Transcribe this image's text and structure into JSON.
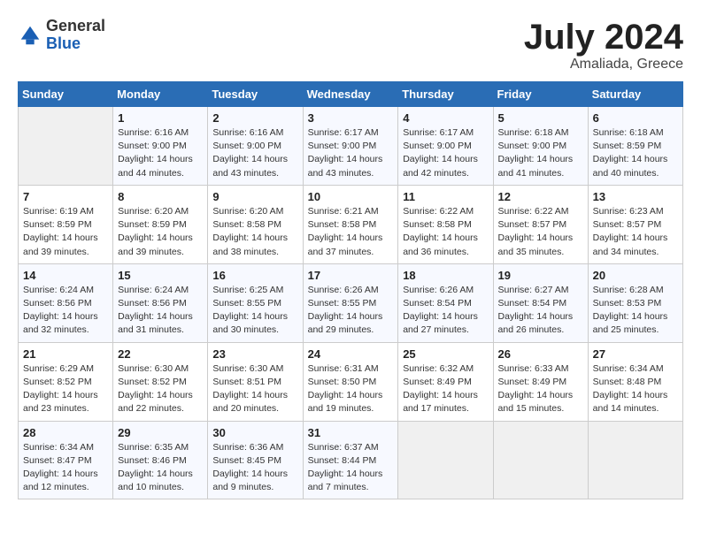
{
  "header": {
    "logo": {
      "general": "General",
      "blue": "Blue"
    },
    "month": "July 2024",
    "location": "Amaliada, Greece"
  },
  "columns": [
    "Sunday",
    "Monday",
    "Tuesday",
    "Wednesday",
    "Thursday",
    "Friday",
    "Saturday"
  ],
  "weeks": [
    {
      "days": [
        {
          "number": "",
          "info": ""
        },
        {
          "number": "1",
          "info": "Sunrise: 6:16 AM\nSunset: 9:00 PM\nDaylight: 14 hours\nand 44 minutes."
        },
        {
          "number": "2",
          "info": "Sunrise: 6:16 AM\nSunset: 9:00 PM\nDaylight: 14 hours\nand 43 minutes."
        },
        {
          "number": "3",
          "info": "Sunrise: 6:17 AM\nSunset: 9:00 PM\nDaylight: 14 hours\nand 43 minutes."
        },
        {
          "number": "4",
          "info": "Sunrise: 6:17 AM\nSunset: 9:00 PM\nDaylight: 14 hours\nand 42 minutes."
        },
        {
          "number": "5",
          "info": "Sunrise: 6:18 AM\nSunset: 9:00 PM\nDaylight: 14 hours\nand 41 minutes."
        },
        {
          "number": "6",
          "info": "Sunrise: 6:18 AM\nSunset: 8:59 PM\nDaylight: 14 hours\nand 40 minutes."
        }
      ]
    },
    {
      "days": [
        {
          "number": "7",
          "info": "Sunrise: 6:19 AM\nSunset: 8:59 PM\nDaylight: 14 hours\nand 39 minutes."
        },
        {
          "number": "8",
          "info": "Sunrise: 6:20 AM\nSunset: 8:59 PM\nDaylight: 14 hours\nand 39 minutes."
        },
        {
          "number": "9",
          "info": "Sunrise: 6:20 AM\nSunset: 8:58 PM\nDaylight: 14 hours\nand 38 minutes."
        },
        {
          "number": "10",
          "info": "Sunrise: 6:21 AM\nSunset: 8:58 PM\nDaylight: 14 hours\nand 37 minutes."
        },
        {
          "number": "11",
          "info": "Sunrise: 6:22 AM\nSunset: 8:58 PM\nDaylight: 14 hours\nand 36 minutes."
        },
        {
          "number": "12",
          "info": "Sunrise: 6:22 AM\nSunset: 8:57 PM\nDaylight: 14 hours\nand 35 minutes."
        },
        {
          "number": "13",
          "info": "Sunrise: 6:23 AM\nSunset: 8:57 PM\nDaylight: 14 hours\nand 34 minutes."
        }
      ]
    },
    {
      "days": [
        {
          "number": "14",
          "info": "Sunrise: 6:24 AM\nSunset: 8:56 PM\nDaylight: 14 hours\nand 32 minutes."
        },
        {
          "number": "15",
          "info": "Sunrise: 6:24 AM\nSunset: 8:56 PM\nDaylight: 14 hours\nand 31 minutes."
        },
        {
          "number": "16",
          "info": "Sunrise: 6:25 AM\nSunset: 8:55 PM\nDaylight: 14 hours\nand 30 minutes."
        },
        {
          "number": "17",
          "info": "Sunrise: 6:26 AM\nSunset: 8:55 PM\nDaylight: 14 hours\nand 29 minutes."
        },
        {
          "number": "18",
          "info": "Sunrise: 6:26 AM\nSunset: 8:54 PM\nDaylight: 14 hours\nand 27 minutes."
        },
        {
          "number": "19",
          "info": "Sunrise: 6:27 AM\nSunset: 8:54 PM\nDaylight: 14 hours\nand 26 minutes."
        },
        {
          "number": "20",
          "info": "Sunrise: 6:28 AM\nSunset: 8:53 PM\nDaylight: 14 hours\nand 25 minutes."
        }
      ]
    },
    {
      "days": [
        {
          "number": "21",
          "info": "Sunrise: 6:29 AM\nSunset: 8:52 PM\nDaylight: 14 hours\nand 23 minutes."
        },
        {
          "number": "22",
          "info": "Sunrise: 6:30 AM\nSunset: 8:52 PM\nDaylight: 14 hours\nand 22 minutes."
        },
        {
          "number": "23",
          "info": "Sunrise: 6:30 AM\nSunset: 8:51 PM\nDaylight: 14 hours\nand 20 minutes."
        },
        {
          "number": "24",
          "info": "Sunrise: 6:31 AM\nSunset: 8:50 PM\nDaylight: 14 hours\nand 19 minutes."
        },
        {
          "number": "25",
          "info": "Sunrise: 6:32 AM\nSunset: 8:49 PM\nDaylight: 14 hours\nand 17 minutes."
        },
        {
          "number": "26",
          "info": "Sunrise: 6:33 AM\nSunset: 8:49 PM\nDaylight: 14 hours\nand 15 minutes."
        },
        {
          "number": "27",
          "info": "Sunrise: 6:34 AM\nSunset: 8:48 PM\nDaylight: 14 hours\nand 14 minutes."
        }
      ]
    },
    {
      "days": [
        {
          "number": "28",
          "info": "Sunrise: 6:34 AM\nSunset: 8:47 PM\nDaylight: 14 hours\nand 12 minutes."
        },
        {
          "number": "29",
          "info": "Sunrise: 6:35 AM\nSunset: 8:46 PM\nDaylight: 14 hours\nand 10 minutes."
        },
        {
          "number": "30",
          "info": "Sunrise: 6:36 AM\nSunset: 8:45 PM\nDaylight: 14 hours\nand 9 minutes."
        },
        {
          "number": "31",
          "info": "Sunrise: 6:37 AM\nSunset: 8:44 PM\nDaylight: 14 hours\nand 7 minutes."
        },
        {
          "number": "",
          "info": ""
        },
        {
          "number": "",
          "info": ""
        },
        {
          "number": "",
          "info": ""
        }
      ]
    }
  ]
}
